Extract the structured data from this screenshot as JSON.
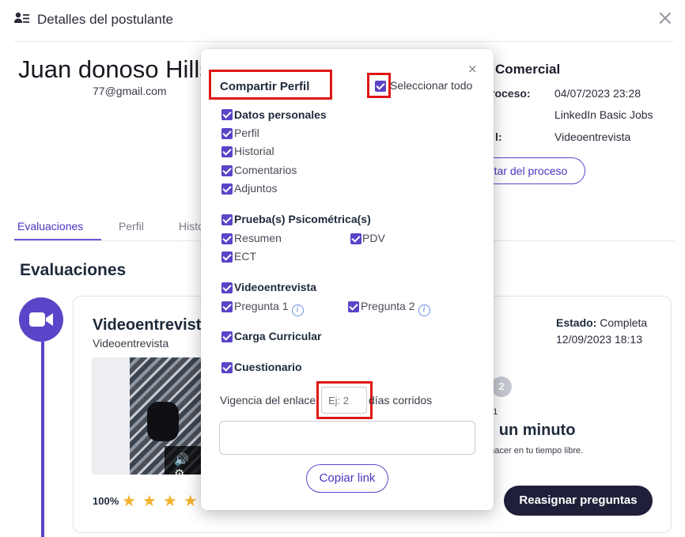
{
  "header": {
    "title": "Detalles del postulante",
    "close": "×"
  },
  "candidate": {
    "name": "Juan donoso Hills",
    "email": "77@gmail.com"
  },
  "job": {
    "title": "Comercial",
    "rows": [
      {
        "label": "roceso:",
        "value": "04/07/2023 23:28"
      },
      {
        "label": "",
        "value": "LinkedIn Basic Jobs"
      },
      {
        "label": "l:",
        "value": "Videoentrevista"
      }
    ],
    "discard_button": "rtar del proceso"
  },
  "tabs": [
    {
      "label": "Evaluaciones",
      "active": true
    },
    {
      "label": "Perfil",
      "active": false
    },
    {
      "label": "Histo",
      "active": false
    }
  ],
  "section_title": "Evaluaciones",
  "evaluation": {
    "title": "Videoentrevista",
    "subtitle": "Videoentrevista",
    "status_label": "Estado:",
    "status_value": "Completa",
    "date": "12/09/2023 18:13",
    "video_controls": "🔊 ⚙",
    "score": "100%",
    "stars": "★★★★",
    "step_number": "2",
    "step_pre": "ta 1",
    "step_title": "n un minuto",
    "step_desc": "a hacer en tu tiempo libre.",
    "reassign_button": "Reasignar preguntas"
  },
  "modal": {
    "close": "×",
    "title": "Compartir Perfil",
    "select_all": "Seleccionar todo",
    "groups": {
      "personal": {
        "title": "Datos personales",
        "items": [
          "Perfil",
          "Historial",
          "Comentarios",
          "Adjuntos"
        ]
      },
      "psico": {
        "title": "Prueba(s) Psicométrica(s)",
        "items": [
          "Resumen",
          "PDV",
          "ECT"
        ]
      },
      "video": {
        "title": "Videoentrevista",
        "items": [
          "Pregunta 1",
          "Pregunta 2"
        ],
        "info_icon": "i"
      },
      "carga": {
        "title": "Carga Curricular"
      },
      "cuestionario": {
        "title": "Cuestionario"
      }
    },
    "validity_label": "Vigencia del enlace",
    "validity_placeholder": "Ej: 2",
    "validity_suffix": "días corridos",
    "copy_button": "Copiar link"
  },
  "colors": {
    "accent": "#5b44c8",
    "highlight": "#e01616",
    "star": "#f2b22c",
    "dark_button": "#1f1f3a"
  }
}
